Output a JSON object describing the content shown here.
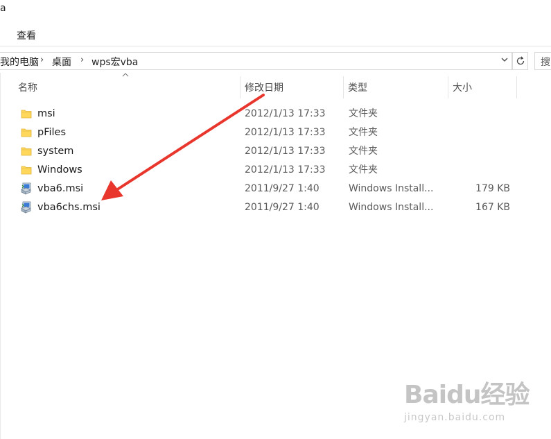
{
  "window": {
    "title_fragment": "a"
  },
  "ribbon": {
    "view_tab": "查看"
  },
  "address": {
    "crumbs": [
      "我的电脑",
      "桌面",
      "wps宏vba"
    ],
    "separator": "›",
    "search_placeholder": "搜"
  },
  "columns": {
    "name": "名称",
    "date": "修改日期",
    "type": "类型",
    "size": "大小"
  },
  "files": [
    {
      "name": "msi",
      "date": "2012/1/13 17:33",
      "type": "文件夹",
      "size": "",
      "icon": "folder-icon"
    },
    {
      "name": "pFiles",
      "date": "2012/1/13 17:33",
      "type": "文件夹",
      "size": "",
      "icon": "folder-icon"
    },
    {
      "name": "system",
      "date": "2012/1/13 17:33",
      "type": "文件夹",
      "size": "",
      "icon": "folder-icon"
    },
    {
      "name": "Windows",
      "date": "2012/1/13 17:33",
      "type": "文件夹",
      "size": "",
      "icon": "folder-icon"
    },
    {
      "name": "vba6.msi",
      "date": "2011/9/27 1:40",
      "type": "Windows Install...",
      "size": "179 KB",
      "icon": "installer-icon"
    },
    {
      "name": "vba6chs.msi",
      "date": "2011/9/27 1:40",
      "type": "Windows Install...",
      "size": "167 KB",
      "icon": "installer-icon"
    }
  ],
  "watermark": {
    "brand": "Baidu经验",
    "url": "jingyan.baidu.com"
  },
  "colors": {
    "folder": "#ffd75a",
    "arrow": "#e8362d",
    "selection": "#cce8ff"
  }
}
